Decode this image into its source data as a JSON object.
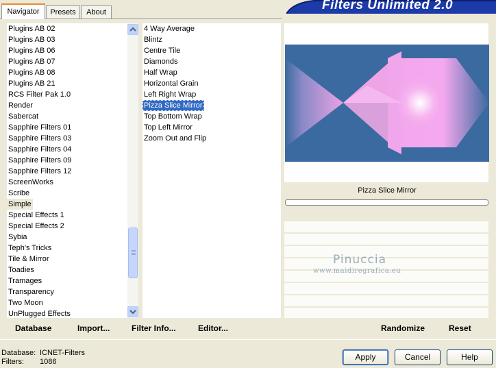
{
  "tabs": [
    {
      "label": "Navigator",
      "active": true
    },
    {
      "label": "Presets",
      "active": false
    },
    {
      "label": "About",
      "active": false
    }
  ],
  "app_title": "Filters Unlimited 2.0",
  "categories": [
    "Plugins AB 02",
    "Plugins AB 03",
    "Plugins AB 06",
    "Plugins AB 07",
    "Plugins AB 08",
    "Plugins AB 21",
    "RCS Filter Pak 1.0",
    "Render",
    "Sabercat",
    "Sapphire Filters 01",
    "Sapphire Filters 03",
    "Sapphire Filters 04",
    "Sapphire Filters 09",
    "Sapphire Filters 12",
    "ScreenWorks",
    "Scribe",
    "Simple",
    "Special Effects 1",
    "Special Effects 2",
    "Sybia",
    "Teph's Tricks",
    "Tile & Mirror",
    "Toadies",
    "Tramages",
    "Transparency",
    "Two Moon",
    "UnPlugged Effects"
  ],
  "selected_category": "Simple",
  "filters": [
    "4 Way Average",
    "Blintz",
    "Centre Tile",
    "Diamonds",
    "Half Wrap",
    "Horizontal Grain",
    "Left Right Wrap",
    "Pizza Slice Mirror",
    "Top Bottom Wrap",
    "Top Left Mirror",
    "Zoom Out and Flip"
  ],
  "selected_filter": "Pizza Slice Mirror",
  "preview_title": "Pizza Slice Mirror",
  "watermark": {
    "name": "Pinuccia",
    "url": "www.maidiregrafica.eu"
  },
  "toolbar": {
    "database": "Database",
    "import": "Import...",
    "filter_info": "Filter Info...",
    "editor": "Editor...",
    "randomize": "Randomize",
    "reset": "Reset"
  },
  "status": {
    "database_label": "Database:",
    "database_value": "ICNET-Filters",
    "filters_label": "Filters:",
    "filters_value": "1086"
  },
  "buttons": {
    "apply": "Apply",
    "cancel": "Cancel",
    "help": "Help"
  },
  "colors": {
    "selection": "#316ac5",
    "preview_blue": "#3a6ea5",
    "preview_pink": "#f0a0e8"
  }
}
